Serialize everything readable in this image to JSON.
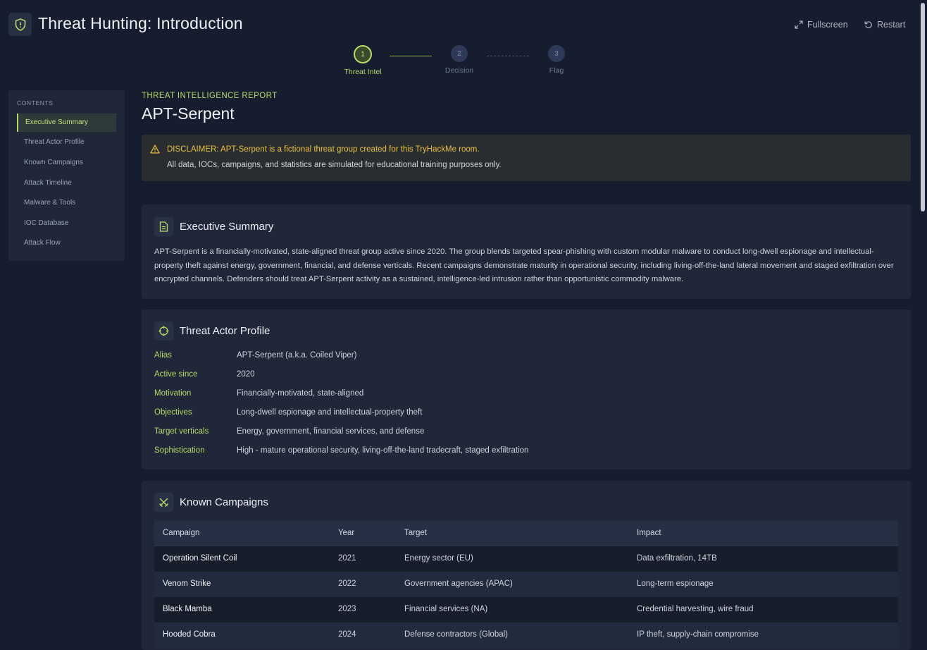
{
  "app": {
    "title": "Threat Hunting: Introduction",
    "fullscreen_label": "Fullscreen",
    "restart_label": "Restart"
  },
  "stepper": {
    "steps": [
      {
        "number": "1",
        "label": "Threat Intel",
        "state": "active"
      },
      {
        "number": "2",
        "label": "Decision",
        "state": "inactive"
      },
      {
        "number": "3",
        "label": "Flag",
        "state": "inactive"
      }
    ]
  },
  "sidebar": {
    "heading": "CONTENTS",
    "items": [
      {
        "label": "Executive Summary",
        "active": true
      },
      {
        "label": "Threat Actor Profile"
      },
      {
        "label": "Known Campaigns"
      },
      {
        "label": "Attack Timeline"
      },
      {
        "label": "Malware & Tools"
      },
      {
        "label": "IOC Database"
      },
      {
        "label": "Attack Flow"
      }
    ]
  },
  "report": {
    "eyebrow": "THREAT INTELLIGENCE REPORT",
    "title": "APT-Serpent",
    "disclaimer_line1": "DISCLAIMER: APT-Serpent is a fictional threat group created for this TryHackMe room.",
    "disclaimer_line2": "All data, IOCs, campaigns, and statistics are simulated for educational training purposes only."
  },
  "executive_summary": {
    "title": "Executive Summary",
    "text": "APT-Serpent is a financially-motivated, state-aligned threat group active since 2020. The group blends targeted spear-phishing with custom modular malware to conduct long-dwell espionage and intellectual-property theft against energy, government, financial, and defense verticals. Recent campaigns demonstrate maturity in operational security, including living-off-the-land lateral movement and staged exfiltration over encrypted channels. Defenders should treat APT-Serpent activity as a sustained, intelligence-led intrusion rather than opportunistic commodity malware."
  },
  "profile": {
    "title": "Threat Actor Profile",
    "rows": [
      {
        "key": "Alias",
        "value": "APT-Serpent (a.k.a. Coiled Viper)"
      },
      {
        "key": "Active since",
        "value": "2020"
      },
      {
        "key": "Motivation",
        "value": "Financially-motivated, state-aligned"
      },
      {
        "key": "Objectives",
        "value": "Long-dwell espionage and intellectual-property theft"
      },
      {
        "key": "Target verticals",
        "value": "Energy, government, financial services, and defense"
      },
      {
        "key": "Sophistication",
        "value": "High - mature operational security, living-off-the-land tradecraft, staged exfiltration"
      }
    ]
  },
  "campaigns": {
    "title": "Known Campaigns",
    "headers": [
      "Campaign",
      "Year",
      "Target",
      "Impact"
    ],
    "rows": [
      [
        "Operation Silent Coil",
        "2021",
        "Energy sector (EU)",
        "Data exfiltration, 14TB"
      ],
      [
        "Venom Strike",
        "2022",
        "Government agencies (APAC)",
        "Long-term espionage"
      ],
      [
        "Black Mamba",
        "2023",
        "Financial services (NA)",
        "Credential harvesting, wire fraud"
      ],
      [
        "Hooded Cobra",
        "2024",
        "Defense contractors (Global)",
        "IP theft, supply-chain compromise"
      ]
    ]
  },
  "colors": {
    "accent": "#b7d86a",
    "background": "#161d2e",
    "card": "#1f2738",
    "warning": "#e9c040"
  },
  "icons": [
    "shield-icon",
    "expand-icon",
    "restart-icon",
    "warning-icon",
    "document-icon",
    "crosshair-icon",
    "swords-icon"
  ]
}
